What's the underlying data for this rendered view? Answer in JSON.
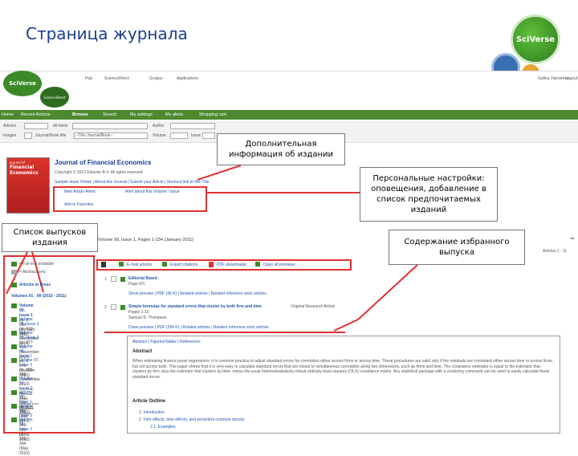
{
  "slide": {
    "title": "Страница журнала",
    "top_logo": "SciVerse"
  },
  "header": {
    "logo": "SciVerse",
    "sub_logo": "ScienceDirect",
    "links": [
      "Hub",
      "ScienceDirect",
      "Scopus",
      "Applications"
    ],
    "user": "Galina Yakovleva",
    "logout": "Logout"
  },
  "nav": {
    "items": [
      "Home",
      "Recent Actions",
      "Browse",
      "Search",
      "My settings",
      "My alerts",
      "Shopping cart"
    ]
  },
  "search": {
    "articles_label": "Articles",
    "all_fields_label": "All fields",
    "author_label": "Author",
    "images_label": "Images",
    "journal_label": "Journal/Book title",
    "journal_select": "--This Journal/Book--",
    "volume_label": "Volume",
    "issue_label": "Issue"
  },
  "journal": {
    "title": "Journal of Financial Economics",
    "copyright": "Copyright © 2012 Elsevier B.V. All rights reserved",
    "links": "Sample Issue Online | About this Journal | Submit your Article | Shortcut link to this Title",
    "cover_line1": "Journal of",
    "cover_line2": "Financial",
    "cover_line3": "Economics",
    "alerts": "New Article Alerts",
    "about_volume": "Alert about this Volume / Issue",
    "favorites": "Add to Favorites"
  },
  "volumes": {
    "avail1": "= Full-text available",
    "avail2": "= Abstract only",
    "in_press": "Articles in Press",
    "range": "Volumes 91 - 99 (2010 - 2011)",
    "list": [
      {
        "t": "Volume 99, Issue 1",
        "s": "pp. 1-234 (January 2011)"
      },
      {
        "t": "Volume 98, Issue 3",
        "s": "pp. 413-650 (December 2010)"
      },
      {
        "t": "Volume 98, Issue 2",
        "s": "pp. 177-414 (November 2010)"
      },
      {
        "t": "Volume 98, Issue 1",
        "s": "pp. 1-176 (October 2010)"
      },
      {
        "t": "Volume 97, Issue 3",
        "s": "pp. 305-488 (September 2010)"
      },
      {
        "t": "Volume 97, Issue 2",
        "s": "pp. 151-304 (August 2010)"
      },
      {
        "t": "Volume 97, Issue 1",
        "s": "pp. 1-150 (July 2010)"
      },
      {
        "t": "Volume 96, Issue 3",
        "s": "pp. 349-520 (June 2010)"
      },
      {
        "t": "Volume 96, Issue 2",
        "s": "pp. 175-344 (May 2010)"
      }
    ],
    "special_note": "The 2008 Financial Crisis: Lessons from Corporate Finance"
  },
  "issue": {
    "heading": "Volume 99, Issue 1, Pages 1-234 (January 2011)",
    "articles_count": "Articles 1 - 11",
    "toolbar": [
      "E-mail articles",
      "Export citations",
      "PDF downloader",
      "Open all previews"
    ],
    "items": [
      {
        "num": "1",
        "title": "Editorial Board",
        "page": "Page IFC",
        "actions": "Show preview | PDF (36 K) | Related articles | Related reference work articles"
      },
      {
        "num": "2",
        "title": "Simple formulas for standard errors that cluster by both firm and time",
        "tag": "Original Research Article",
        "page": "Pages 1-10",
        "author": "Samuel B. Thompson",
        "actions": "Close preview | PDF (284 K) | Related articles | Related reference work articles"
      }
    ]
  },
  "preview": {
    "tabs": "Abstract | Figures/Tables | References",
    "abstract_heading": "Abstract",
    "abstract_text": "When estimating finance panel regressions, it is common practice to adjust standard errors for correlation either across firms or across time. These procedures are valid only if the residuals are correlated either across time or across firms, but not across both. This paper shows that it is very easy to calculate standard errors that are robust to simultaneous correlation along two dimensions, such as firms and time. The covariance estimator is equal to the estimator that clusters by firm, plus the estimator that clusters by time, minus the usual heteroskedasticity-robust ordinary least squares (OLS) covariance matrix. Any statistical package with a clustering command can be used to easily calculate these standard errors.",
    "outline_heading": "Article Outline",
    "outline": [
      "1. Introduction",
      "2. Firm effects, time effects, and persistent common shocks",
      "2.1. Examples"
    ]
  },
  "callouts": {
    "extra_info": "Дополнительная информация об издании",
    "personal": "Персональные настройки: оповещения, добавление в список предпочитаемых изданий",
    "issue_list": "Список выпусков издания",
    "selected": "Содержание избранного выпуска"
  },
  "colors": {
    "nav_green": "#4d8a2f",
    "title_blue": "#1a3d8f",
    "highlight_red": "#e03030"
  }
}
